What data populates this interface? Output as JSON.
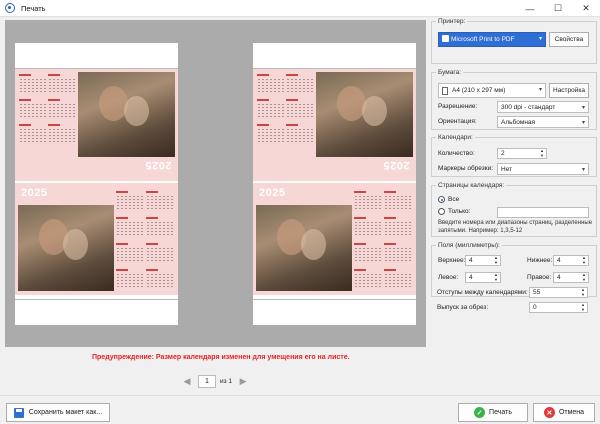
{
  "window": {
    "title": "Печать",
    "minimize_glyph": "—",
    "maximize_glyph": "☐",
    "close_glyph": "✕"
  },
  "preview": {
    "year_label": "2025",
    "warning": "Предупреждение: Размер календаря изменен для умещения его на листе.",
    "page_current": "1",
    "page_of": "из 1",
    "prev_glyph": "◀",
    "next_glyph": "▶"
  },
  "printer": {
    "legend": "Принтер:",
    "selected": "Microsoft Print to PDF",
    "properties_button": "Свойства"
  },
  "paper": {
    "legend": "Бумага:",
    "size": "A4 (210 x 297 мм)",
    "setup_button": "Настройка",
    "resolution_label": "Разрешение:",
    "resolution_value": "300 dpi - стандарт",
    "orientation_label": "Ориентация:",
    "orientation_value": "Альбомная"
  },
  "calendars": {
    "legend": "Календари:",
    "count_label": "Количество:",
    "count_value": "2",
    "markers_label": "Маркеры обрезки:",
    "markers_value": "Нет"
  },
  "pages": {
    "legend": "Страницы календаря:",
    "all_label": "Все",
    "only_label": "Только:",
    "selected_option": "Все",
    "hint": "Введите номера или диапазоны страниц, разделенные запятыми. Например: 1,3,5-12"
  },
  "margins": {
    "legend": "Поля (миллиметры):",
    "top_label": "Верхнее:",
    "top_value": "4",
    "bottom_label": "Нижнее:",
    "bottom_value": "4",
    "left_label": "Левое:",
    "left_value": "4",
    "right_label": "Правое:",
    "right_value": "4",
    "spacing_label": "Отступы между календарями:",
    "spacing_value": "55",
    "bleed_label": "Выпуск за обрез:",
    "bleed_value": "0"
  },
  "footer": {
    "save_layout": "Сохранить макет как...",
    "print": "Печать",
    "cancel": "Отмена"
  },
  "colors": {
    "accent": "#2f6ed5",
    "warning": "#e52222",
    "calendar_pink": "#f7d7d5",
    "ok_green": "#3bb34a",
    "cancel_red": "#e03a3a"
  }
}
